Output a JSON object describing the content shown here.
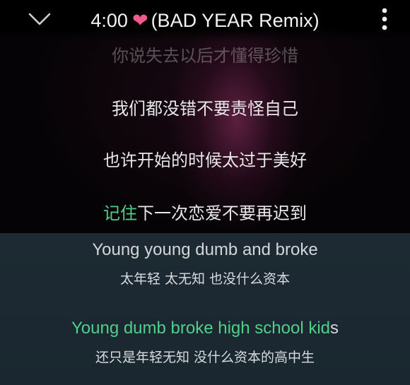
{
  "header": {
    "time": "4:00",
    "heart_icon": "heart-icon",
    "song_name": "(BAD YEAR Remix)",
    "collapse_icon": "chevron-down-icon",
    "more_icon": "more-vertical-icon",
    "heart_color": "#f05a8e"
  },
  "lyrics": {
    "line_faded": "你说失去以后才懂得珍惜",
    "line_1": "我们都没错不要责怪自己",
    "line_2": "也许开始的时候太过于美好",
    "line_3_played": "记住",
    "line_3_rest": "下一次恋爱不要再迟到"
  },
  "subtitles": {
    "en_1": "Young young dumb and broke",
    "zh_1": "太年轻 太无知 也没什么资本",
    "en_2_played": "Young dumb broke high school kid",
    "en_2_rest": "s",
    "zh_2": "还只是年轻无知 没什么资本的高中生"
  },
  "colors": {
    "highlight": "#4fd08a",
    "panel_bg": "#1d2a33",
    "background": "#000000"
  }
}
